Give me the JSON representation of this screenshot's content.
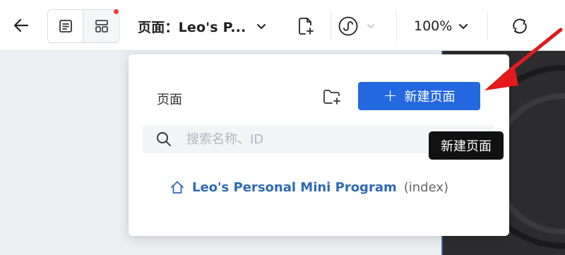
{
  "toolbar": {
    "page_select_label": "页面：Leo's P...",
    "zoom_label": "100%"
  },
  "panel": {
    "title": "页面",
    "new_page_button": {
      "plus": "+",
      "label": "新建页面"
    },
    "search": {
      "placeholder": "搜索名称、ID",
      "value": ""
    },
    "pages": [
      {
        "name": "Leo's Personal Mini Program",
        "suffix": "(index)"
      }
    ]
  },
  "tooltip": {
    "text": "新建页面"
  },
  "colors": {
    "accent": "#2468e0",
    "link": "#2e6ab4",
    "annotation_arrow": "#e3191c",
    "tooltip_bg": "#111111"
  },
  "icons": [
    "back-arrow-icon",
    "list-view-icon",
    "layout-view-icon",
    "chevron-down-icon",
    "new-file-icon",
    "mini-program-icon",
    "refresh-icon",
    "new-folder-icon",
    "plus-icon",
    "search-icon",
    "home-icon"
  ]
}
